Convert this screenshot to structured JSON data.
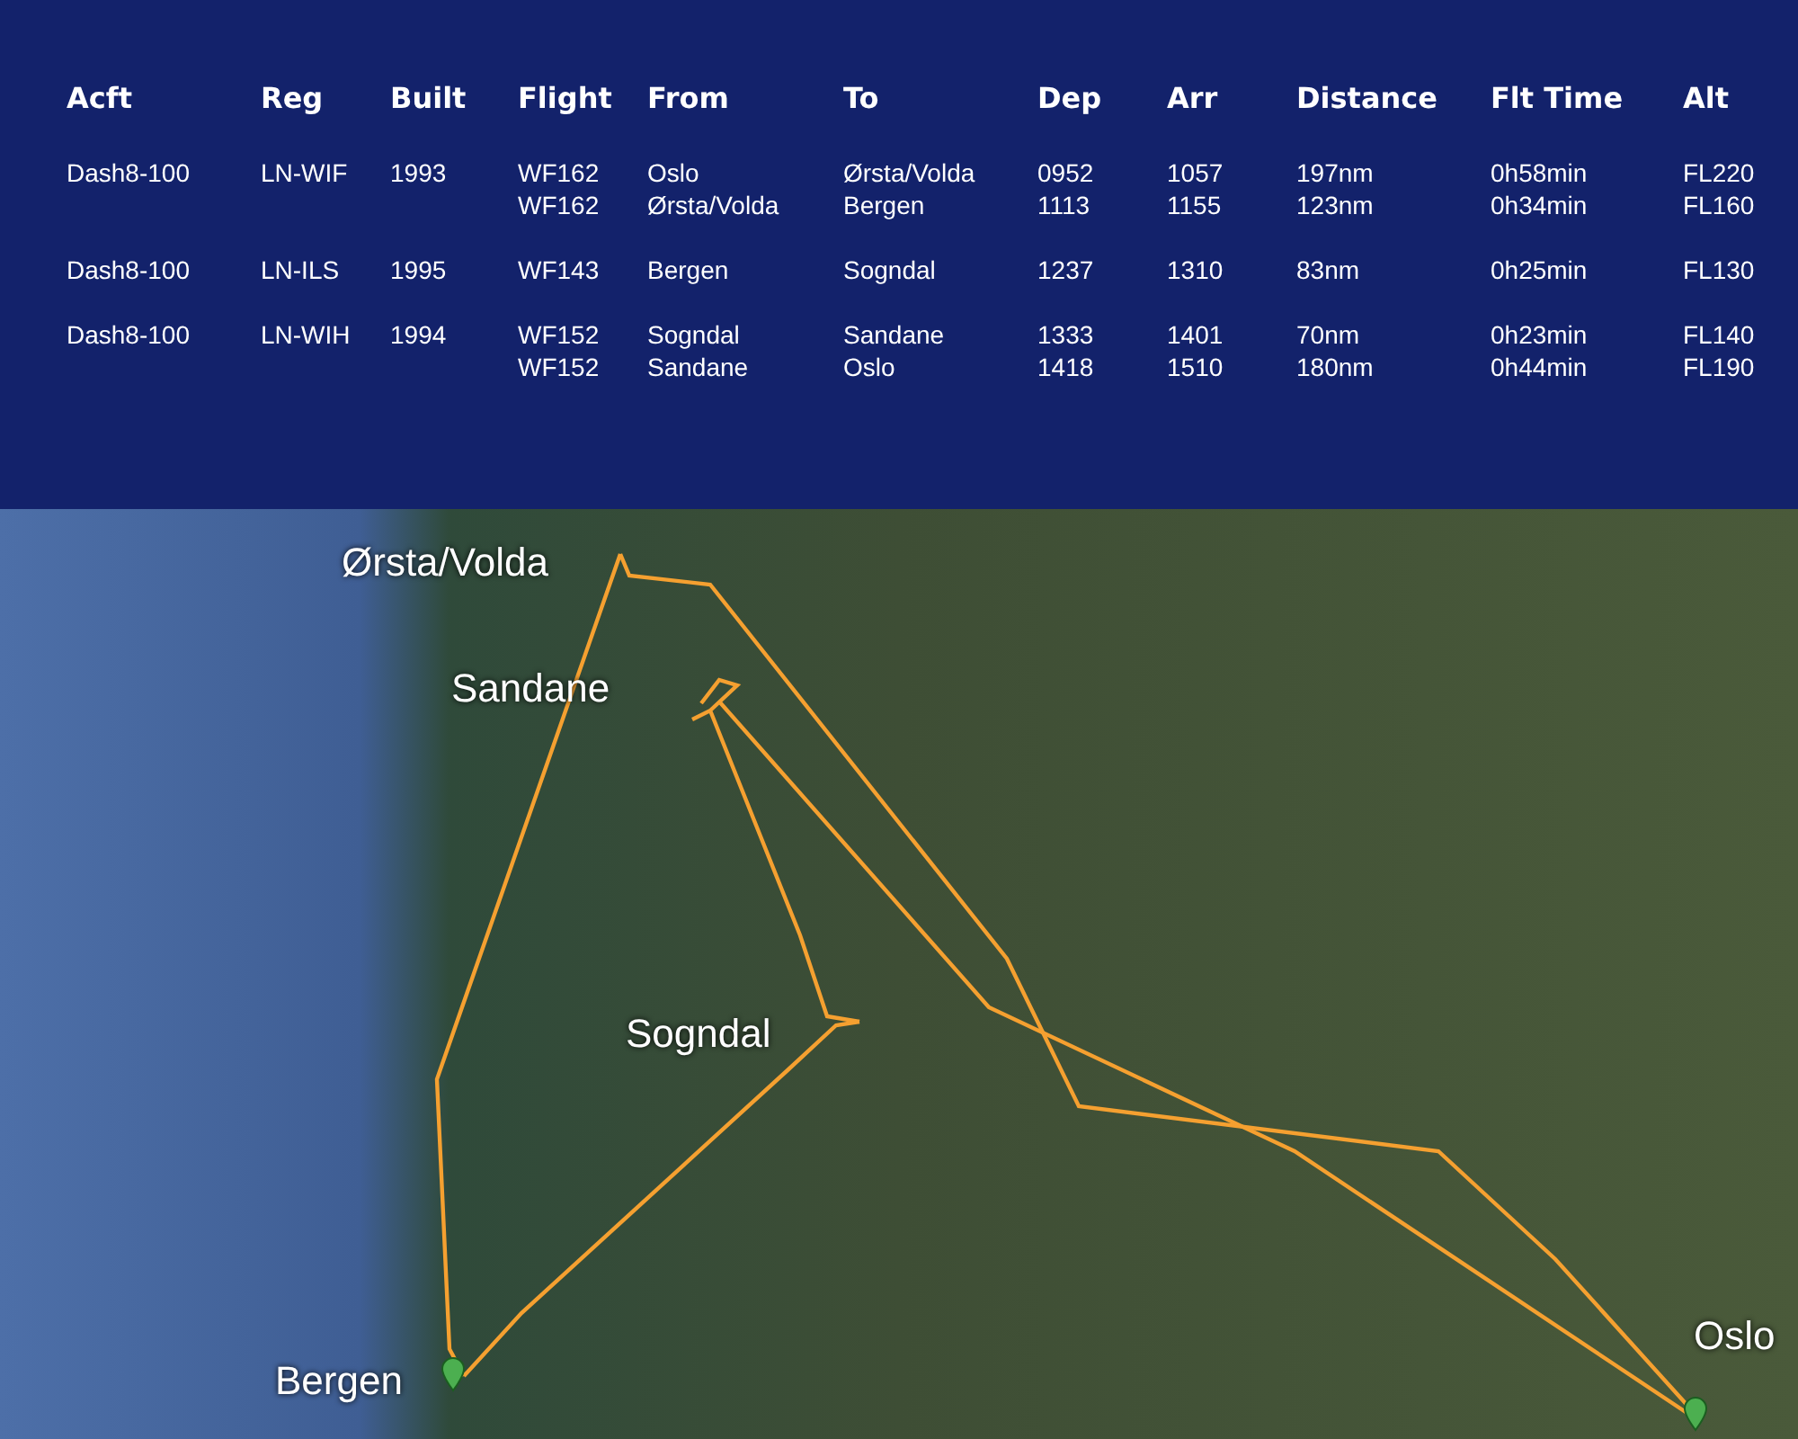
{
  "table": {
    "columns": [
      "Acft",
      "Reg",
      "Built",
      "Flight",
      "From",
      "To",
      "Dep",
      "Arr",
      "Distance",
      "Flt Time",
      "Alt"
    ],
    "aircraft": [
      {
        "acft": "Dash8-100",
        "reg": "LN-WIF",
        "built": "1993",
        "legs": [
          {
            "flight": "WF162",
            "from": "Oslo",
            "to": "Ørsta/Volda",
            "dep": "0952",
            "arr": "1057",
            "distance": "197nm",
            "flt_time": "0h58min",
            "alt": "FL220"
          },
          {
            "flight": "WF162",
            "from": "Ørsta/Volda",
            "to": "Bergen",
            "dep": "1113",
            "arr": "1155",
            "distance": "123nm",
            "flt_time": "0h34min",
            "alt": "FL160"
          }
        ]
      },
      {
        "acft": "Dash8-100",
        "reg": "LN-ILS",
        "built": "1995",
        "legs": [
          {
            "flight": "WF143",
            "from": "Bergen",
            "to": "Sogndal",
            "dep": "1237",
            "arr": "1310",
            "distance": "83nm",
            "flt_time": "0h25min",
            "alt": "FL130"
          }
        ]
      },
      {
        "acft": "Dash8-100",
        "reg": "LN-WIH",
        "built": "1994",
        "legs": [
          {
            "flight": "WF152",
            "from": "Sogndal",
            "to": "Sandane",
            "dep": "1333",
            "arr": "1401",
            "distance": "70nm",
            "flt_time": "0h23min",
            "alt": "FL140"
          },
          {
            "flight": "WF152",
            "from": "Sandane",
            "to": "Oslo",
            "dep": "1418",
            "arr": "1510",
            "distance": "180nm",
            "flt_time": "0h44min",
            "alt": "FL190"
          }
        ]
      }
    ]
  },
  "map": {
    "labels": [
      "Ørsta/Volda",
      "Sandane",
      "Sogndal",
      "Bergen",
      "Oslo"
    ]
  }
}
